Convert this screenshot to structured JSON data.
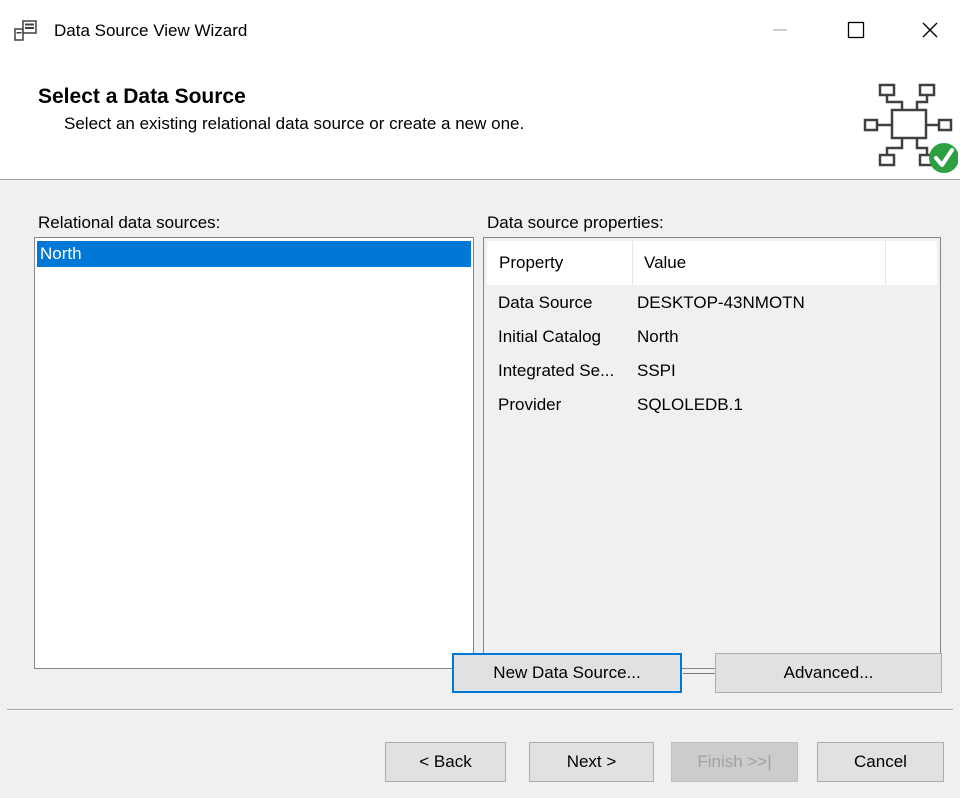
{
  "window": {
    "title": "Data Source View Wizard",
    "controls": {
      "minimize_icon": "minimize-icon",
      "maximize_icon": "maximize-icon",
      "close_icon": "close-icon"
    }
  },
  "header": {
    "title": "Select a Data Source",
    "subtitle": "Select an existing relational data source or create a new one.",
    "graphic_icon": "data-source-network-icon",
    "accent_color": "#2ea043"
  },
  "relational_sources": {
    "label": "Relational data sources:",
    "items": [
      {
        "label": "North",
        "selected": true
      }
    ],
    "selection_color": "#0078d7"
  },
  "properties": {
    "label": "Data source properties:",
    "columns": [
      "Property",
      "Value"
    ],
    "rows": [
      {
        "property": "Data Source",
        "value": "DESKTOP-43NMOTN"
      },
      {
        "property": "Initial Catalog",
        "value": "North"
      },
      {
        "property": "Integrated Se...",
        "value": "SSPI"
      },
      {
        "property": "Provider",
        "value": "SQLOLEDB.1"
      }
    ]
  },
  "actions": {
    "new_data_source": "New Data Source...",
    "advanced": "Advanced..."
  },
  "footer": {
    "back": "< Back",
    "next": "Next >",
    "finish": "Finish >>|",
    "cancel": "Cancel"
  }
}
